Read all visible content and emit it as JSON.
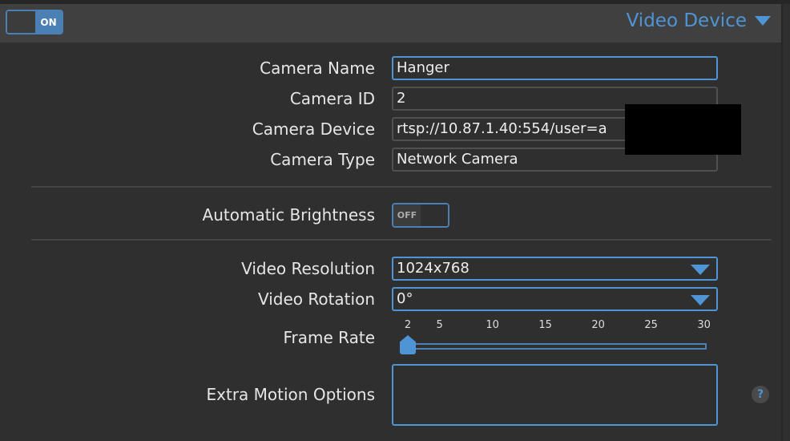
{
  "header": {
    "toggle_label": "ON",
    "title": "Video Device"
  },
  "fields": {
    "camera_name": {
      "label": "Camera Name",
      "value": "Hanger"
    },
    "camera_id": {
      "label": "Camera ID",
      "value": "2"
    },
    "camera_device": {
      "label": "Camera Device",
      "value": "rtsp://10.87.1.40:554/user=a"
    },
    "camera_type": {
      "label": "Camera Type",
      "value": "Network Camera"
    },
    "auto_brightness": {
      "label": "Automatic Brightness",
      "toggle_label": "OFF"
    },
    "video_resolution": {
      "label": "Video Resolution",
      "value": "1024x768"
    },
    "video_rotation": {
      "label": "Video Rotation",
      "value": "0°"
    },
    "frame_rate": {
      "label": "Frame Rate",
      "value": 2,
      "min": 2,
      "max": 30,
      "ticks": [
        "2",
        "5",
        "10",
        "15",
        "20",
        "25",
        "30"
      ]
    },
    "extra_motion": {
      "label": "Extra Motion Options",
      "value": ""
    }
  },
  "help": {
    "icon": "?"
  }
}
